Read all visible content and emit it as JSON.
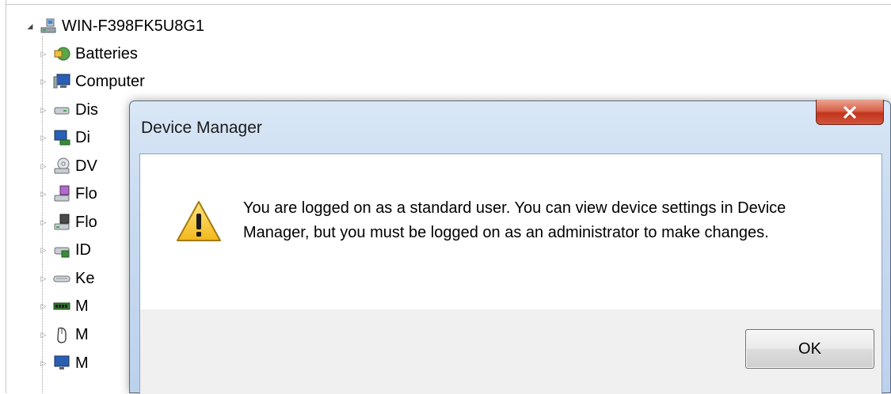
{
  "tree": {
    "root_label": "WIN-F398FK5U8G1",
    "items": [
      {
        "label": "Batteries",
        "icon": "battery-icon"
      },
      {
        "label": "Computer",
        "icon": "computer-icon"
      },
      {
        "label": "Disk drives",
        "icon": "disk-drive-icon"
      },
      {
        "label": "Display adapters",
        "icon": "display-adapter-icon"
      },
      {
        "label": "DVD/CD-ROM drives",
        "icon": "dvd-drive-icon"
      },
      {
        "label": "Floppy disk controllers",
        "icon": "floppy-controller-icon"
      },
      {
        "label": "Floppy disk drives",
        "icon": "floppy-drive-icon"
      },
      {
        "label": "IDE ATA/ATAPI controllers",
        "icon": "ide-controller-icon"
      },
      {
        "label": "Keyboards",
        "icon": "keyboard-icon"
      },
      {
        "label": "Memory technology devices",
        "icon": "memory-icon"
      },
      {
        "label": "Mice and other pointing devices",
        "icon": "mouse-icon"
      },
      {
        "label": "Monitors",
        "icon": "monitor-icon"
      }
    ],
    "visible_labels": [
      "Batteries",
      "Computer",
      "Dis",
      "Di",
      "DV",
      "Flo",
      "Flo",
      "ID",
      "Ke",
      "M",
      "M",
      "M"
    ]
  },
  "dialog": {
    "title": "Device Manager",
    "message": "You are logged on as a standard user. You can view device settings in Device Manager, but you must be logged on as an administrator to make changes.",
    "ok_label": "OK",
    "close_glyph": "X"
  }
}
